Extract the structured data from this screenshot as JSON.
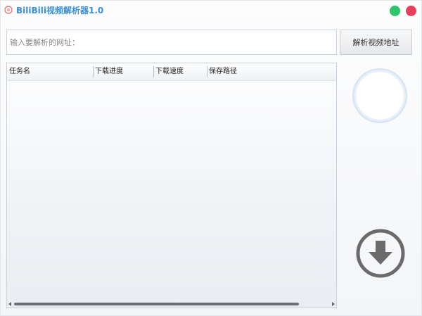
{
  "window": {
    "title": "BiliBili视频解析器1.0",
    "accent_color": "#3a8fd8",
    "maximize_color": "#2ec46a",
    "close_color": "#e8405a"
  },
  "url_bar": {
    "placeholder": "输入要解析的网址：",
    "value": ""
  },
  "parse_button": {
    "label": "解析视频地址"
  },
  "task_table": {
    "columns": [
      "任务名",
      "下载进度",
      "下载速度",
      "保存路径"
    ],
    "rows": []
  },
  "icons": {
    "app": "bilibili-icon",
    "download": "download-arrow-icon",
    "progress": "progress-ring-icon"
  }
}
